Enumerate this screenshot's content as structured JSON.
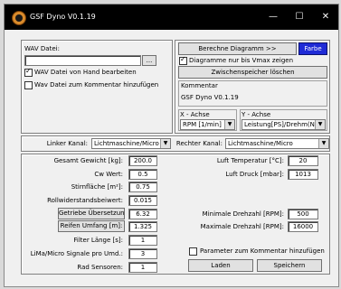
{
  "window": {
    "title": "GSF Dyno V0.1.19",
    "minimize": "—",
    "maximize": "☐",
    "close": "✕"
  },
  "left_top": {
    "wav_label": "WAV Datei:",
    "wav_value": "",
    "browse": "...",
    "chk_manual": "WAV Datei von Hand bearbeiten",
    "chk_manual_checked": true,
    "chk_comment": "Wav Datei zum Kommentar hinzufügen",
    "chk_comment_checked": false
  },
  "right_top": {
    "calc_button": "Berechne Diagramm >>",
    "color_button": "Farbe",
    "chk_vmax": "Diagramme nur bis Vmax zeigen",
    "chk_vmax_checked": true,
    "clipboard_button": "Zwischenspeicher löschen",
    "comment_label": "Kommentar",
    "comment_value": "GSF Dyno V0.1.19",
    "x_axis_label": "X - Achse",
    "x_axis_value": "RPM [1/min]",
    "y_axis_label": "Y - Achse",
    "y_axis_value": "Leistung[PS]/Drehm(Nm)"
  },
  "channels": {
    "left_label": "Linker Kanal:",
    "left_value": "Lichtmaschine/Micro",
    "right_label": "Rechter Kanal:",
    "right_value": "Lichtmaschine/Micro"
  },
  "params": {
    "gesamt_gewicht_label": "Gesamt Gewicht [kg]:",
    "gesamt_gewicht": "200.0",
    "cw_label": "Cw Wert:",
    "cw": "0.5",
    "stirnflaeche_label": "Stirnfläche [m²]:",
    "stirnflaeche": "0.75",
    "rollwiderstand_label": "Rollwiderstandsbeiwert:",
    "rollwiderstand": "0.015",
    "getriebe_button": "Getriebe Übersetzung:",
    "getriebe": "6.32",
    "reifen_button": "Reifen Umfang [m]:",
    "reifen": "1.325",
    "filter_label": "Filter Länge [s]:",
    "filter": "1",
    "signale_label": "LiMa/Micro Signale pro Umd.:",
    "signale": "3",
    "rad_label": "Rad Sensoren:",
    "rad": "1",
    "temp_label": "Luft Temperatur [°C]:",
    "temp": "20",
    "druck_label": "Luft Druck [mbar]:",
    "druck": "1013",
    "min_label": "Minimale Drehzahl [RPM]:",
    "min": "500",
    "max_label": "Maximale Drehzahl [RPM]:",
    "max": "16000",
    "chk_params": "Parameter zum Kommentar hinzufügen",
    "chk_params_checked": false,
    "load_button": "Laden",
    "save_button": "Speichern"
  },
  "colors": {
    "titlebar": "#000000",
    "accent": "#1f2bd6"
  }
}
